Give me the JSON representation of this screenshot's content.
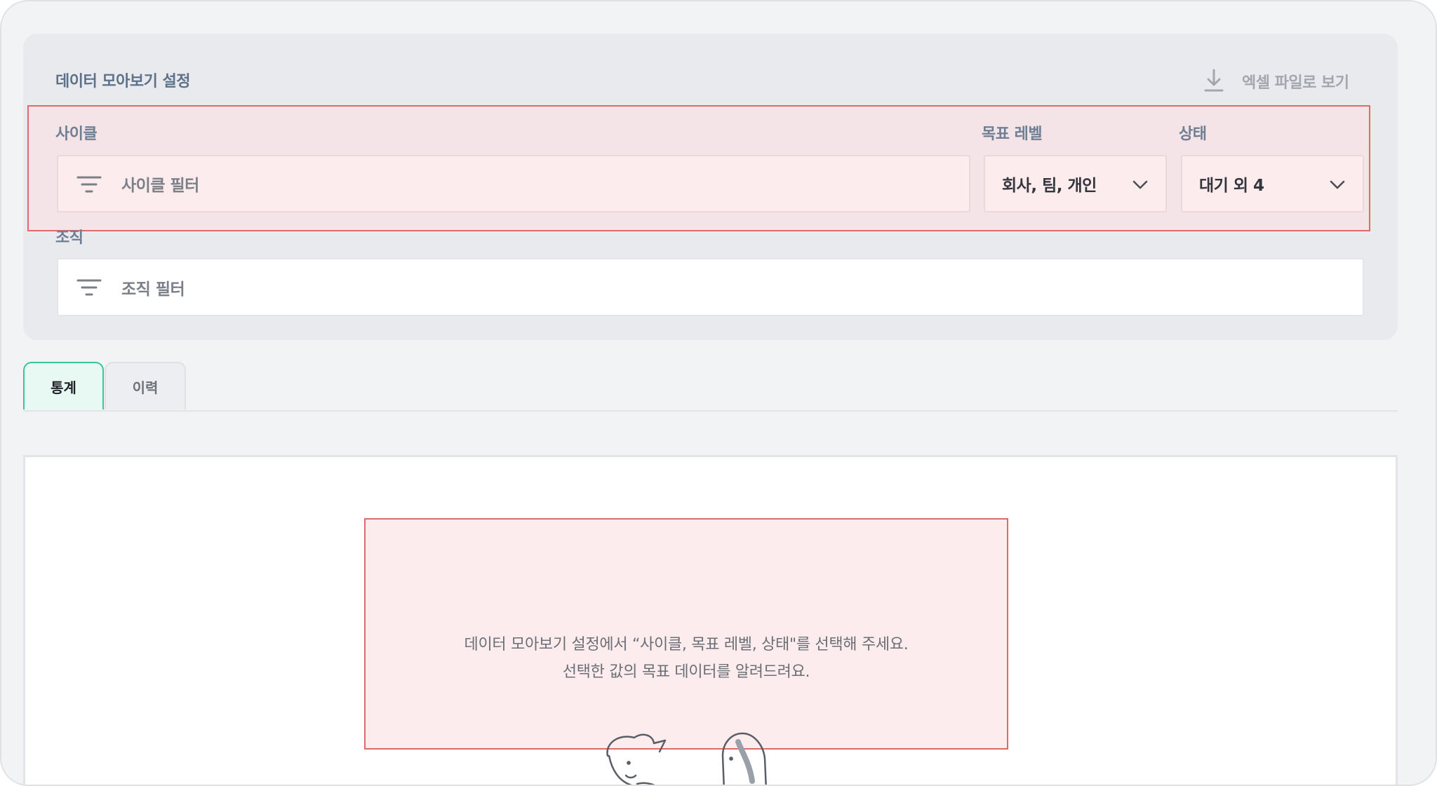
{
  "settings": {
    "title": "데이터 모아보기 설정",
    "excel_label": "엑셀 파일로 보기",
    "cycle": {
      "label": "사이클",
      "placeholder": "사이클 필터"
    },
    "goal_level": {
      "label": "목표 레벨",
      "value": "회사, 팀, 개인"
    },
    "status": {
      "label": "상태",
      "value": "대기 외 4"
    },
    "organization": {
      "label": "조직",
      "placeholder": "조직 필터"
    }
  },
  "tabs": [
    {
      "label": "통계",
      "active": true
    },
    {
      "label": "이력",
      "active": false
    }
  ],
  "empty_state": {
    "line1": "데이터 모아보기 설정에서 “사이클, 목표 레벨, 상태\"를 선택해 주세요.",
    "line2": "선택한 값의 목표 데이터를 알려드려요."
  },
  "colors": {
    "accent": "#3bc496",
    "highlight_border": "#e06a6a",
    "highlight_fill": "#fdeced"
  },
  "icons": [
    "download-icon",
    "filter-icon",
    "chevron-down-icon"
  ]
}
